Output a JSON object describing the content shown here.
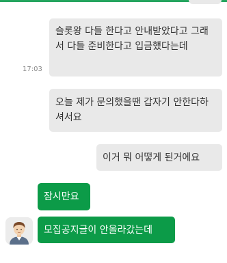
{
  "messages": [
    {
      "from": "me",
      "text": "슬롯왕 다들 한다고 안내받았다고 그래서 다들 준비한다고 입금했다는데",
      "time": "17:03"
    },
    {
      "from": "me",
      "text": "오늘 제가 문의했을땐 갑자기 안한다하셔서요"
    },
    {
      "from": "me",
      "text": "이거 뭐 어떻게 된거에요"
    },
    {
      "from": "agent",
      "text": "잠시만요"
    },
    {
      "from": "agent",
      "text": "모집공지글이 안올라갔는데"
    }
  ],
  "colors": {
    "outgoing_bubble": "#e9e9e9",
    "incoming_bubble": "#0c9b48",
    "top_accent": "#25a55f"
  },
  "avatar": {
    "icon": "person-avatar-icon"
  }
}
